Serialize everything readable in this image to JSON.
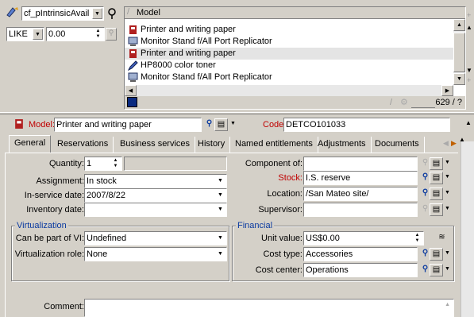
{
  "filter": {
    "field_value": "cf_pIntrinsicAvail",
    "operator": "LIKE",
    "value": "0.00"
  },
  "list": {
    "column_header": "Model",
    "rows": [
      {
        "label": "Printer and writing paper",
        "icon": "book-icon"
      },
      {
        "label": "Monitor Stand f/All Port Replicator",
        "icon": "computer-icon"
      },
      {
        "label": "Printer and writing paper",
        "icon": "book-icon"
      },
      {
        "label": "HP8000 color toner",
        "icon": "pencil-icon"
      },
      {
        "label": "Monitor Stand f/All Port Replicator",
        "icon": "computer-icon"
      }
    ],
    "count": "629 / ?"
  },
  "detail": {
    "model_label": "Model:",
    "model_value": "Printer and writing paper",
    "code_label": "Code:",
    "code_value": "DETCO101033"
  },
  "tabs": [
    "General",
    "Reservations",
    "Business services",
    "History",
    "Named entitlements",
    "Adjustments",
    "Documents"
  ],
  "fields": {
    "quantity_label": "Quantity:",
    "quantity_value": "1",
    "assignment_label": "Assignment:",
    "assignment_value": "In stock",
    "inservice_label": "In-service date:",
    "inservice_value": "2007/8/22",
    "inventory_label": "Inventory date:",
    "inventory_value": "",
    "component_label": "Component of:",
    "component_value": "",
    "stock_label": "Stock:",
    "stock_value": "I.S. reserve",
    "location_label": "Location:",
    "location_value": "/San Mateo site/",
    "supervisor_label": "Supervisor:",
    "supervisor_value": ""
  },
  "virtualization": {
    "title": "Virtualization",
    "vi_label": "Can be part of VI:",
    "vi_value": "Undefined",
    "role_label": "Virtualization role:",
    "role_value": "None"
  },
  "financial": {
    "title": "Financial",
    "unit_label": "Unit value:",
    "unit_value": "US$0.00",
    "cost_type_label": "Cost type:",
    "cost_type_value": "Accessories",
    "cost_center_label": "Cost center:",
    "cost_center_value": "Operations"
  },
  "comment": {
    "label": "Comment:",
    "value": ""
  },
  "colors": {
    "face": "#d4d0c8",
    "required": "#c00000",
    "group_title": "#0a3aa0"
  }
}
